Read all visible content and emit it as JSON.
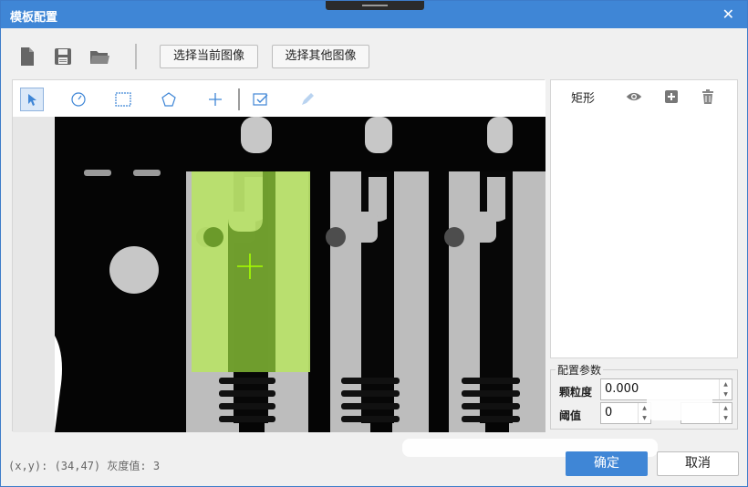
{
  "window": {
    "title": "模板配置",
    "close_glyph": "✕"
  },
  "toolbar": {
    "icons": [
      "new-file-icon",
      "save-icon",
      "open-folder-icon"
    ],
    "btn_current": "选择当前图像",
    "btn_other": "选择其他图像"
  },
  "viewer": {
    "tools": [
      "pointer-icon",
      "circle-tool-icon",
      "rectangle-tool-icon",
      "polygon-tool-icon",
      "crosshair-tool-icon",
      "checkbox-tool-icon",
      "pencil-tool-icon"
    ],
    "selected_tool": "pointer-icon"
  },
  "shape_panel": {
    "label": "矩形",
    "icons": [
      "eye-icon",
      "add-square-icon",
      "trash-icon"
    ]
  },
  "config": {
    "title": "配置参数",
    "granularity_label": "颗粒度",
    "granularity_value": "0.000",
    "threshold_label": "阈值",
    "threshold_value": "0"
  },
  "status": {
    "text": "(x,y): (34,47) 灰度值: 3"
  },
  "footer": {
    "ok_label": "确定",
    "cancel_label": "取消"
  },
  "colors": {
    "accent": "#3f86d6",
    "roi_fill": "#b8e06a",
    "roi_center": "#6b9a2a",
    "crosshair": "#a6ff00"
  }
}
